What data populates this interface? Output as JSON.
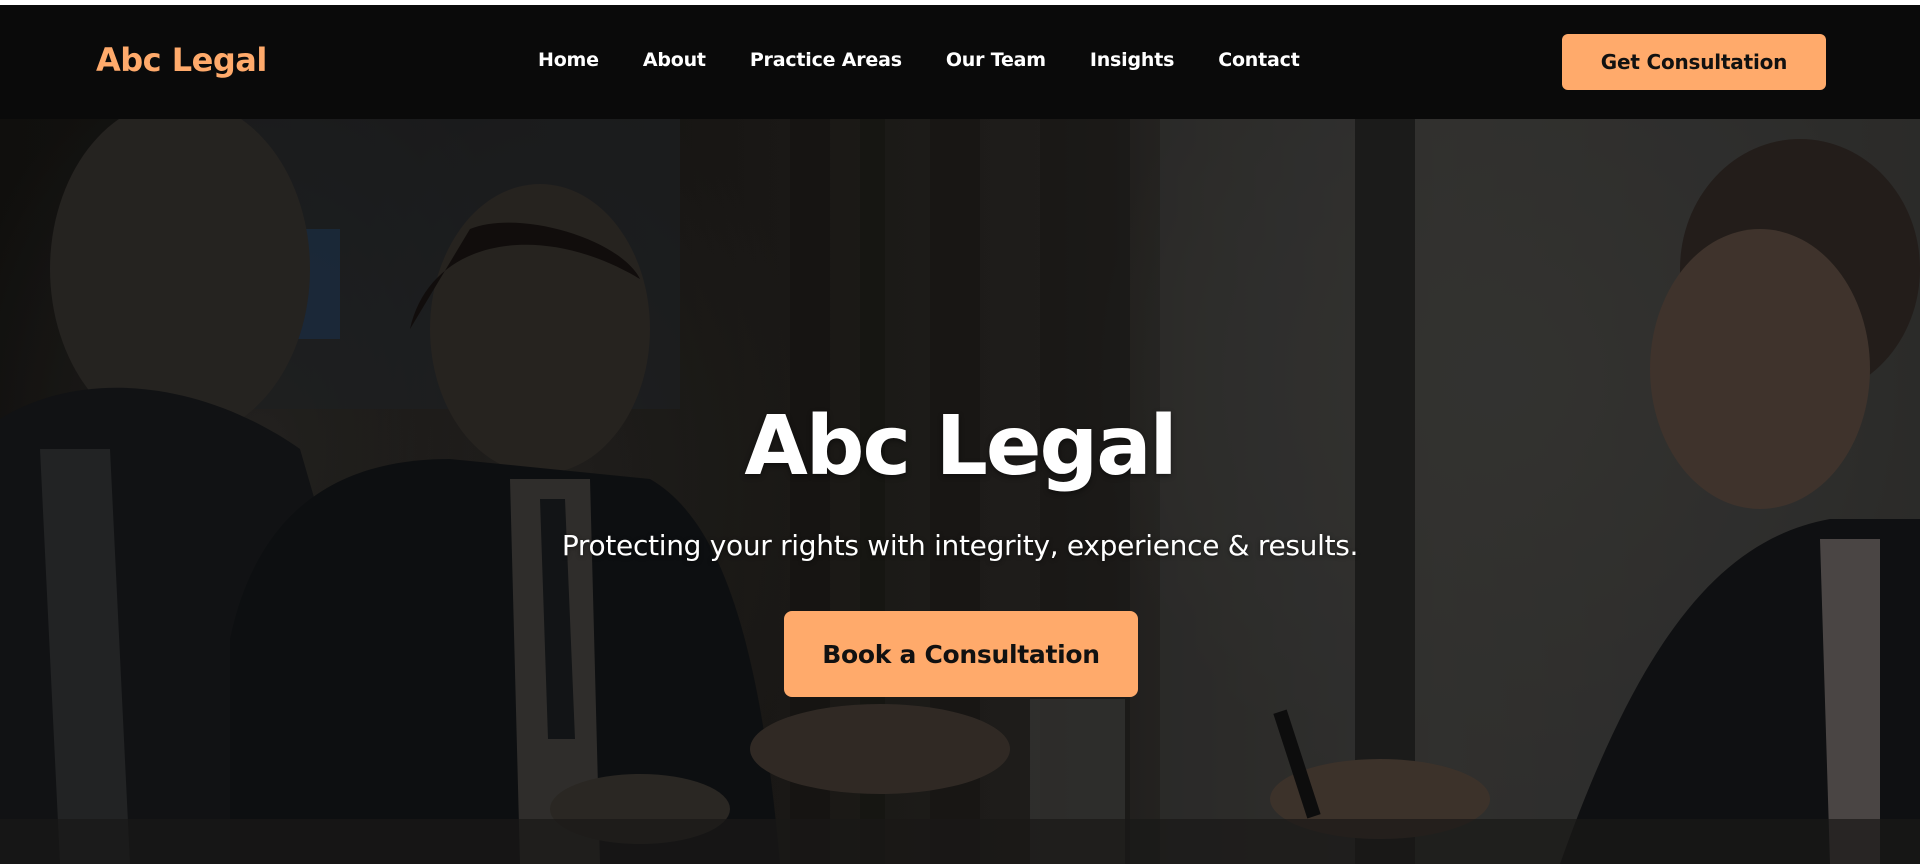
{
  "brand": {
    "name": "Abc Legal"
  },
  "nav": {
    "links": [
      "Home",
      "About",
      "Practice Areas",
      "Our Team",
      "Insights",
      "Contact"
    ],
    "cta_label": "Get Consultation"
  },
  "hero": {
    "title": "Abc Legal",
    "subtitle": "Protecting your rights with integrity, experience & results.",
    "cta_label": "Book a Consultation"
  },
  "colors": {
    "accent": "#ffaa6b",
    "navbar_bg": "#0a0a0a",
    "text_light": "#ffffff",
    "button_text": "#111111"
  }
}
